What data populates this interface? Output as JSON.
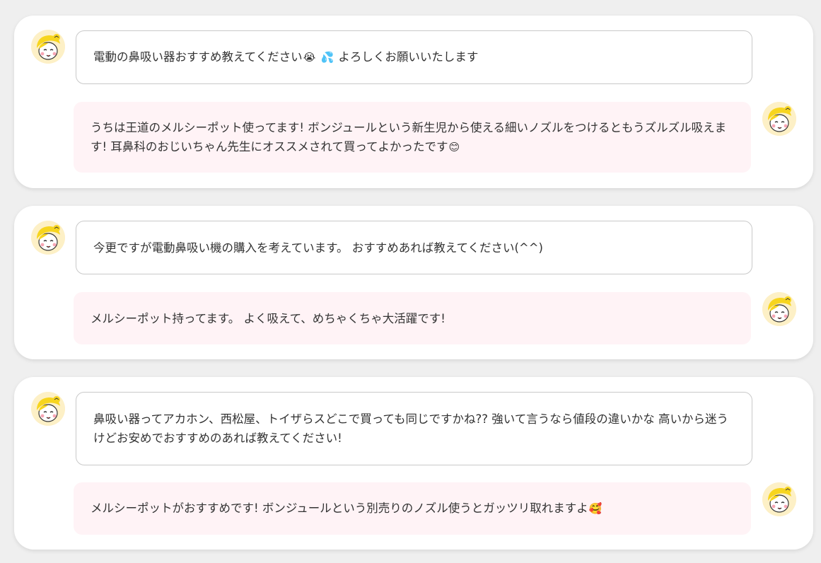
{
  "threads": [
    {
      "question": {
        "text": "電動の鼻吸い器おすすめ教えてください",
        "emoji1": "😭",
        "emoji2": "💦",
        "text2": " よろしくお願いいたします"
      },
      "answer": {
        "text": "うちは王道のメルシーポット使ってます! ボンジュールという新生児から使える細いノズルをつけるともうズルズル吸えます! 耳鼻科のおじいちゃん先生にオススメされて買ってよかったです",
        "emoji1": "😊"
      }
    },
    {
      "question": {
        "text": "今更ですが電動鼻吸い機の購入を考えています。 おすすめあれば教えてください(^^)"
      },
      "answer": {
        "text": "メルシーポット持ってます。 よく吸えて、めちゃくちゃ大活躍です!"
      }
    },
    {
      "question": {
        "text": "鼻吸い器ってアカホン、西松屋、トイザらスどこで買っても同じですかね?? 強いて言うなら値段の違いかな 高いから迷うけどお安めでおすすめのあれば教えてください!"
      },
      "answer": {
        "text": "メルシーポットがおすすめです! ボンジュールという別売りのノズル使うとガッツリ取れますよ",
        "emoji1": "🥰"
      }
    }
  ],
  "icons": {
    "avatar": "user-avatar-icon"
  },
  "colors": {
    "page_bg": "#efefef",
    "card_bg": "#ffffff",
    "answer_bg": "#fff3f6",
    "question_border": "#c9c9c9",
    "avatar_bg": "#fdf0c6"
  }
}
